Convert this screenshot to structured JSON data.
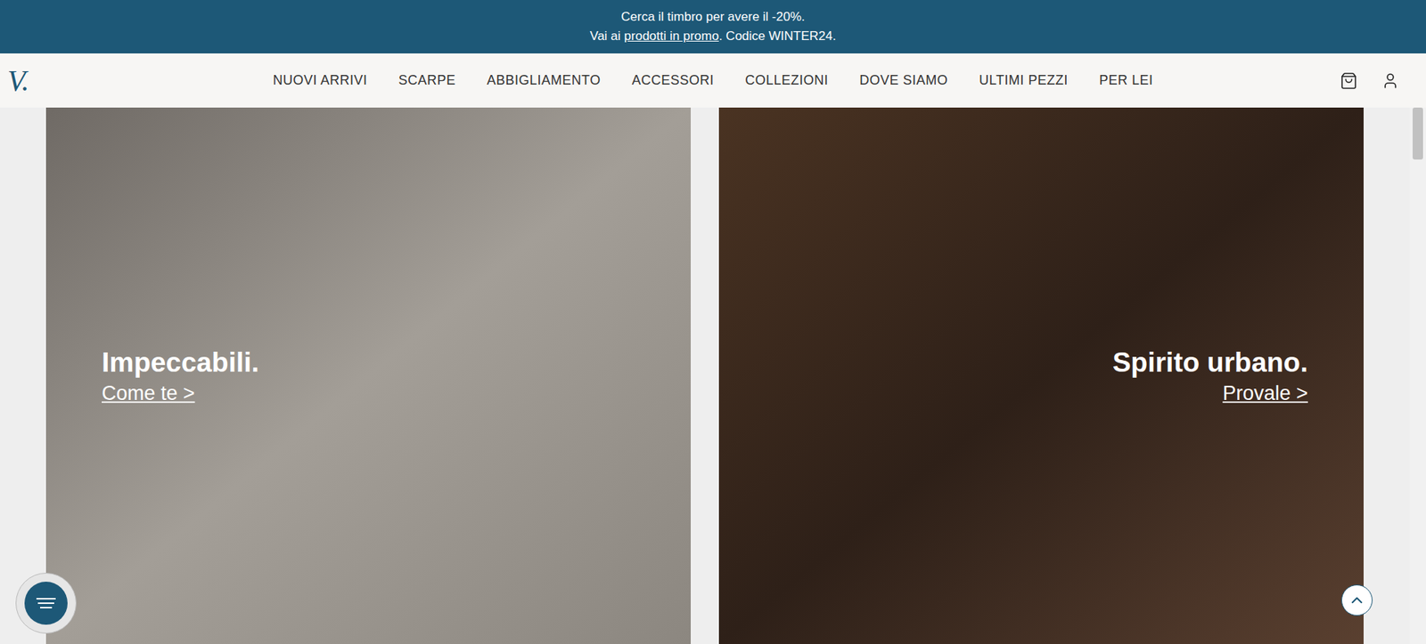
{
  "promo_banner": {
    "line1": "Cerca il timbro per avere il -20%.",
    "line2_prefix": "Vai ai ",
    "line2_link": "prodotti in promo",
    "line2_suffix": ". Codice WINTER24."
  },
  "logo": "V.",
  "nav": {
    "items": [
      "NUOVI ARRIVI",
      "SCARPE",
      "ABBIGLIAMENTO",
      "ACCESSORI",
      "COLLEZIONI",
      "DOVE SIAMO",
      "ULTIMI PEZZI",
      "PER LEI"
    ]
  },
  "cards": [
    {
      "title": "Impeccabili.",
      "link": "Come te >"
    },
    {
      "title": "Spirito urbano.",
      "link": "Provale >"
    }
  ]
}
